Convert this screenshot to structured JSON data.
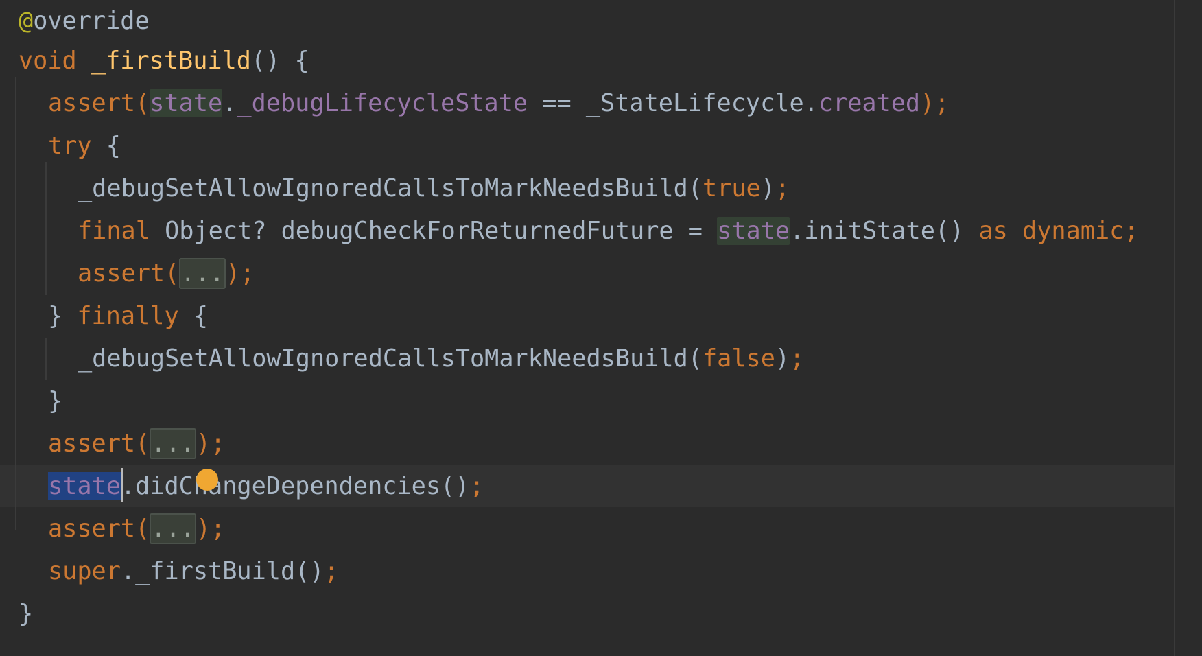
{
  "editor": {
    "language": "dart",
    "lines": [
      {
        "annotation_at": "@",
        "annotation_rest": "override"
      },
      {
        "kw_void": "void",
        "fn_name": "_firstBuild",
        "rest": "() {"
      },
      {
        "kw_assert": "assert",
        "paren_open": "(",
        "state": "state",
        "dot": ".",
        "field_lifecycle": "_debugLifecycleState",
        "middle": " == _StateLifecycle.",
        "field_created": "created",
        "paren_close": ")",
        "semi": ";"
      },
      {
        "kw_try": "try",
        "rest": " {"
      },
      {
        "call": "_debugSetAllowIgnoredCallsToMarkNeedsBuild(",
        "kw_true": "true",
        "close": ")",
        "semi": ";"
      },
      {
        "kw_final": "final",
        "decl": " Object? debugCheckForReturnedFuture = ",
        "state": "state",
        "call": ".initState() ",
        "kw_as": "as",
        "space": " ",
        "kw_dynamic": "dynamic",
        "semi": ";"
      },
      {
        "kw_assert": "assert",
        "open": "(",
        "fold": "...",
        "close": ")",
        "semi": ";"
      },
      {
        "brace": "} ",
        "kw_finally": "finally",
        "rest": " {"
      },
      {
        "call": "_debugSetAllowIgnoredCallsToMarkNeedsBuild(",
        "kw_false": "false",
        "close": ")",
        "semi": ";"
      },
      {
        "brace": "}"
      },
      {
        "kw_assert": "assert",
        "open": "(",
        "fold": "...",
        "close": ")",
        "semi": ";"
      },
      {
        "state": "state",
        "call": ".didChangeDependencies()",
        "semi": ";"
      },
      {
        "kw_assert": "assert",
        "open": "(",
        "fold": "...",
        "close": ")",
        "semi": ";"
      },
      {
        "kw_super": "super",
        "call": "._firstBuild()",
        "semi": ";"
      },
      {
        "brace": "}"
      }
    ],
    "intention_bulb_icon": "lightbulb-icon",
    "colors": {
      "background": "#2b2b2b",
      "keyword": "#cc7832",
      "function": "#ffc66d",
      "field": "#9876aa",
      "annotation": "#bbb529",
      "text": "#a9b7c6",
      "selection": "#214283",
      "bulb": "#f0a732"
    }
  }
}
